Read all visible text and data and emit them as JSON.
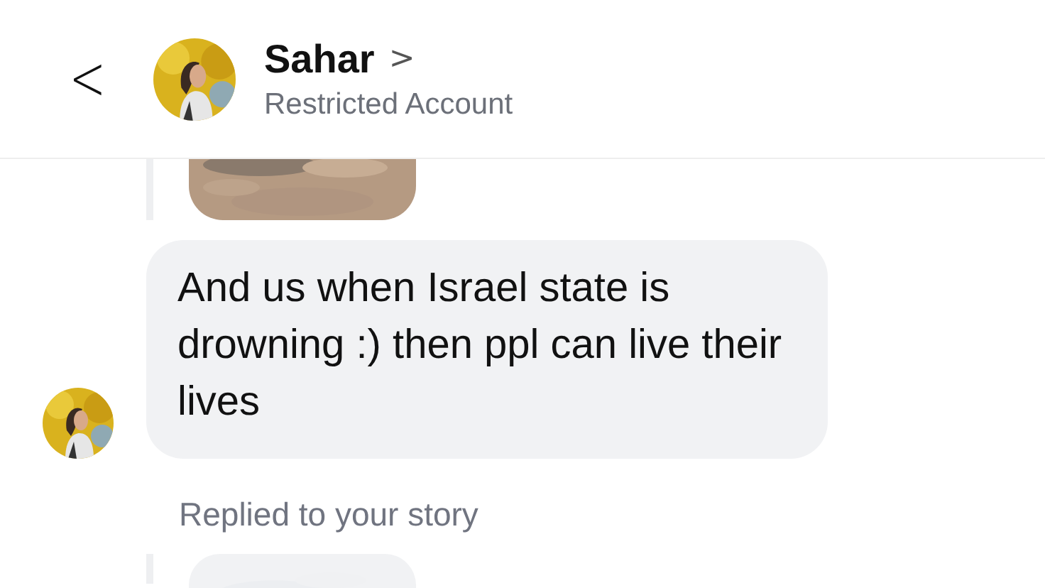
{
  "header": {
    "back": "<",
    "name": "Sahar",
    "chevron": ">",
    "subtitle": "Restricted Account"
  },
  "messages": [
    {
      "kind": "story_preview"
    },
    {
      "kind": "text",
      "text": "And us when Israel state is drowning :) then ppl can live their lives"
    },
    {
      "kind": "reply_label",
      "text": "Replied to your story"
    },
    {
      "kind": "story_preview"
    }
  ]
}
